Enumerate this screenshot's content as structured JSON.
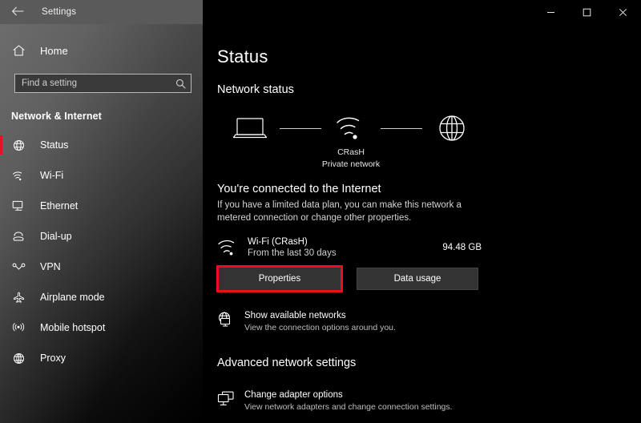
{
  "titlebar": {
    "back_icon": "back-arrow-icon",
    "title": "Settings",
    "minimize": "minimize-icon",
    "maximize": "maximize-icon",
    "close": "close-icon"
  },
  "sidebar": {
    "home_label": "Home",
    "home_icon": "home-icon",
    "search": {
      "placeholder": "Find a setting",
      "value": "",
      "icon": "search-icon"
    },
    "section_title": "Network & Internet",
    "selected_accent": "#e81123",
    "items": [
      {
        "label": "Status",
        "icon": "globe-icon",
        "selected": true
      },
      {
        "label": "Wi-Fi",
        "icon": "wifi-icon",
        "selected": false
      },
      {
        "label": "Ethernet",
        "icon": "monitor-icon",
        "selected": false
      },
      {
        "label": "Dial-up",
        "icon": "telephone-icon",
        "selected": false
      },
      {
        "label": "VPN",
        "icon": "vpn-icon",
        "selected": false
      },
      {
        "label": "Airplane mode",
        "icon": "airplane-icon",
        "selected": false
      },
      {
        "label": "Mobile hotspot",
        "icon": "hotspot-icon",
        "selected": false
      },
      {
        "label": "Proxy",
        "icon": "globe-grid-icon",
        "selected": false
      }
    ]
  },
  "main": {
    "page_title": "Status",
    "network_status_heading": "Network status",
    "diagram": {
      "device_icon": "laptop-icon",
      "link_icon": "connection-line",
      "network_icon": "wifi-icon",
      "internet_icon": "globe-icon",
      "network_name": "CRasH",
      "network_type": "Private network"
    },
    "connected_heading": "You're connected to the Internet",
    "connected_description": "If you have a limited data plan, you can make this network a metered connection or change other properties.",
    "usage": {
      "icon": "wifi-icon",
      "name": "Wi-Fi (CRasH)",
      "period": "From the last 30 days",
      "amount": "94.48 GB"
    },
    "buttons": {
      "properties": "Properties",
      "data_usage": "Data usage",
      "highlight_color": "#f20d1c"
    },
    "show_networks": {
      "icon": "network-monitor-icon",
      "title": "Show available networks",
      "subtitle": "View the connection options around you."
    },
    "advanced_heading": "Advanced network settings",
    "change_adapter": {
      "icon": "adapter-icon",
      "title": "Change adapter options",
      "subtitle": "View network adapters and change connection settings."
    }
  }
}
